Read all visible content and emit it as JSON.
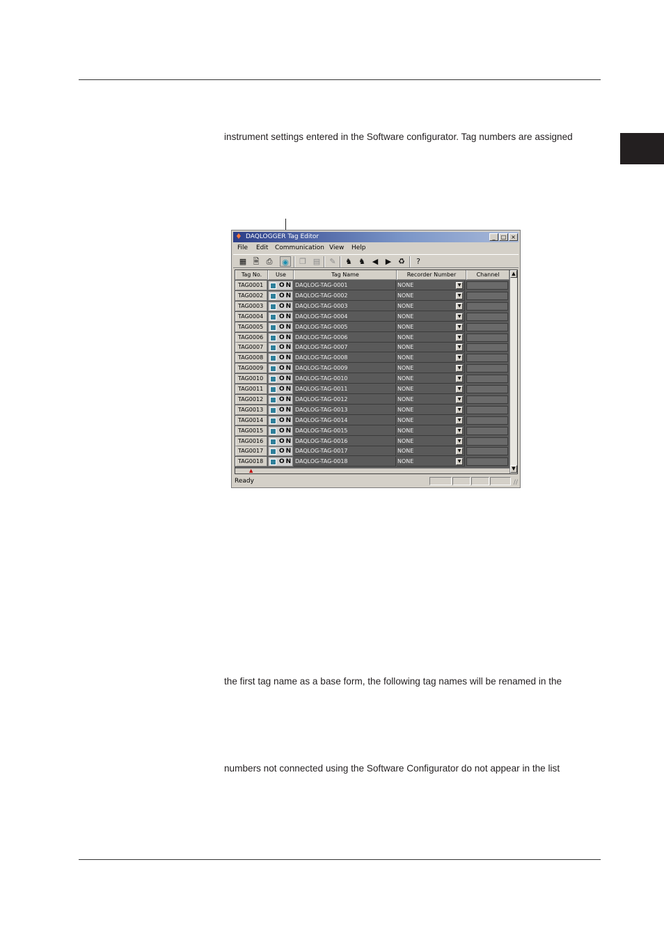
{
  "paragraphs": {
    "p1": "instrument settings entered in the Software configurator.  Tag numbers are assigned",
    "p2": "the first tag name as a base form, the following tag names will be renamed in the",
    "p3": "numbers not connected using the Software Configurator do not appear in the list"
  },
  "window": {
    "title": "DAQLOGGER Tag Editor",
    "menu": [
      "File",
      "Edit",
      "Communication",
      "View",
      "Help"
    ],
    "columns": {
      "tag_no": "Tag No.",
      "use": "Use",
      "tag_name": "Tag Name",
      "recorder": "Recorder Number",
      "channel": "Channel"
    },
    "rows": [
      {
        "tag_no": "TAG0001",
        "use": "ON",
        "tag_name": "DAQLOG-TAG-0001",
        "recorder": "NONE"
      },
      {
        "tag_no": "TAG0002",
        "use": "ON",
        "tag_name": "DAQLOG-TAG-0002",
        "recorder": "NONE"
      },
      {
        "tag_no": "TAG0003",
        "use": "ON",
        "tag_name": "DAQLOG-TAG-0003",
        "recorder": "NONE"
      },
      {
        "tag_no": "TAG0004",
        "use": "ON",
        "tag_name": "DAQLOG-TAG-0004",
        "recorder": "NONE"
      },
      {
        "tag_no": "TAG0005",
        "use": "ON",
        "tag_name": "DAQLOG-TAG-0005",
        "recorder": "NONE"
      },
      {
        "tag_no": "TAG0006",
        "use": "ON",
        "tag_name": "DAQLOG-TAG-0006",
        "recorder": "NONE"
      },
      {
        "tag_no": "TAG0007",
        "use": "ON",
        "tag_name": "DAQLOG-TAG-0007",
        "recorder": "NONE"
      },
      {
        "tag_no": "TAG0008",
        "use": "ON",
        "tag_name": "DAQLOG-TAG-0008",
        "recorder": "NONE"
      },
      {
        "tag_no": "TAG0009",
        "use": "ON",
        "tag_name": "DAQLOG-TAG-0009",
        "recorder": "NONE"
      },
      {
        "tag_no": "TAG0010",
        "use": "ON",
        "tag_name": "DAQLOG-TAG-0010",
        "recorder": "NONE"
      },
      {
        "tag_no": "TAG0011",
        "use": "ON",
        "tag_name": "DAQLOG-TAG-0011",
        "recorder": "NONE"
      },
      {
        "tag_no": "TAG0012",
        "use": "ON",
        "tag_name": "DAQLOG-TAG-0012",
        "recorder": "NONE"
      },
      {
        "tag_no": "TAG0013",
        "use": "ON",
        "tag_name": "DAQLOG-TAG-0013",
        "recorder": "NONE"
      },
      {
        "tag_no": "TAG0014",
        "use": "ON",
        "tag_name": "DAQLOG-TAG-0014",
        "recorder": "NONE"
      },
      {
        "tag_no": "TAG0015",
        "use": "ON",
        "tag_name": "DAQLOG-TAG-0015",
        "recorder": "NONE"
      },
      {
        "tag_no": "TAG0016",
        "use": "ON",
        "tag_name": "DAQLOG-TAG-0016",
        "recorder": "NONE"
      },
      {
        "tag_no": "TAG0017",
        "use": "ON",
        "tag_name": "DAQLOG-TAG-0017",
        "recorder": "NONE"
      },
      {
        "tag_no": "TAG0018",
        "use": "ON",
        "tag_name": "DAQLOG-TAG-0018",
        "recorder": "NONE"
      }
    ],
    "status": "Ready"
  }
}
